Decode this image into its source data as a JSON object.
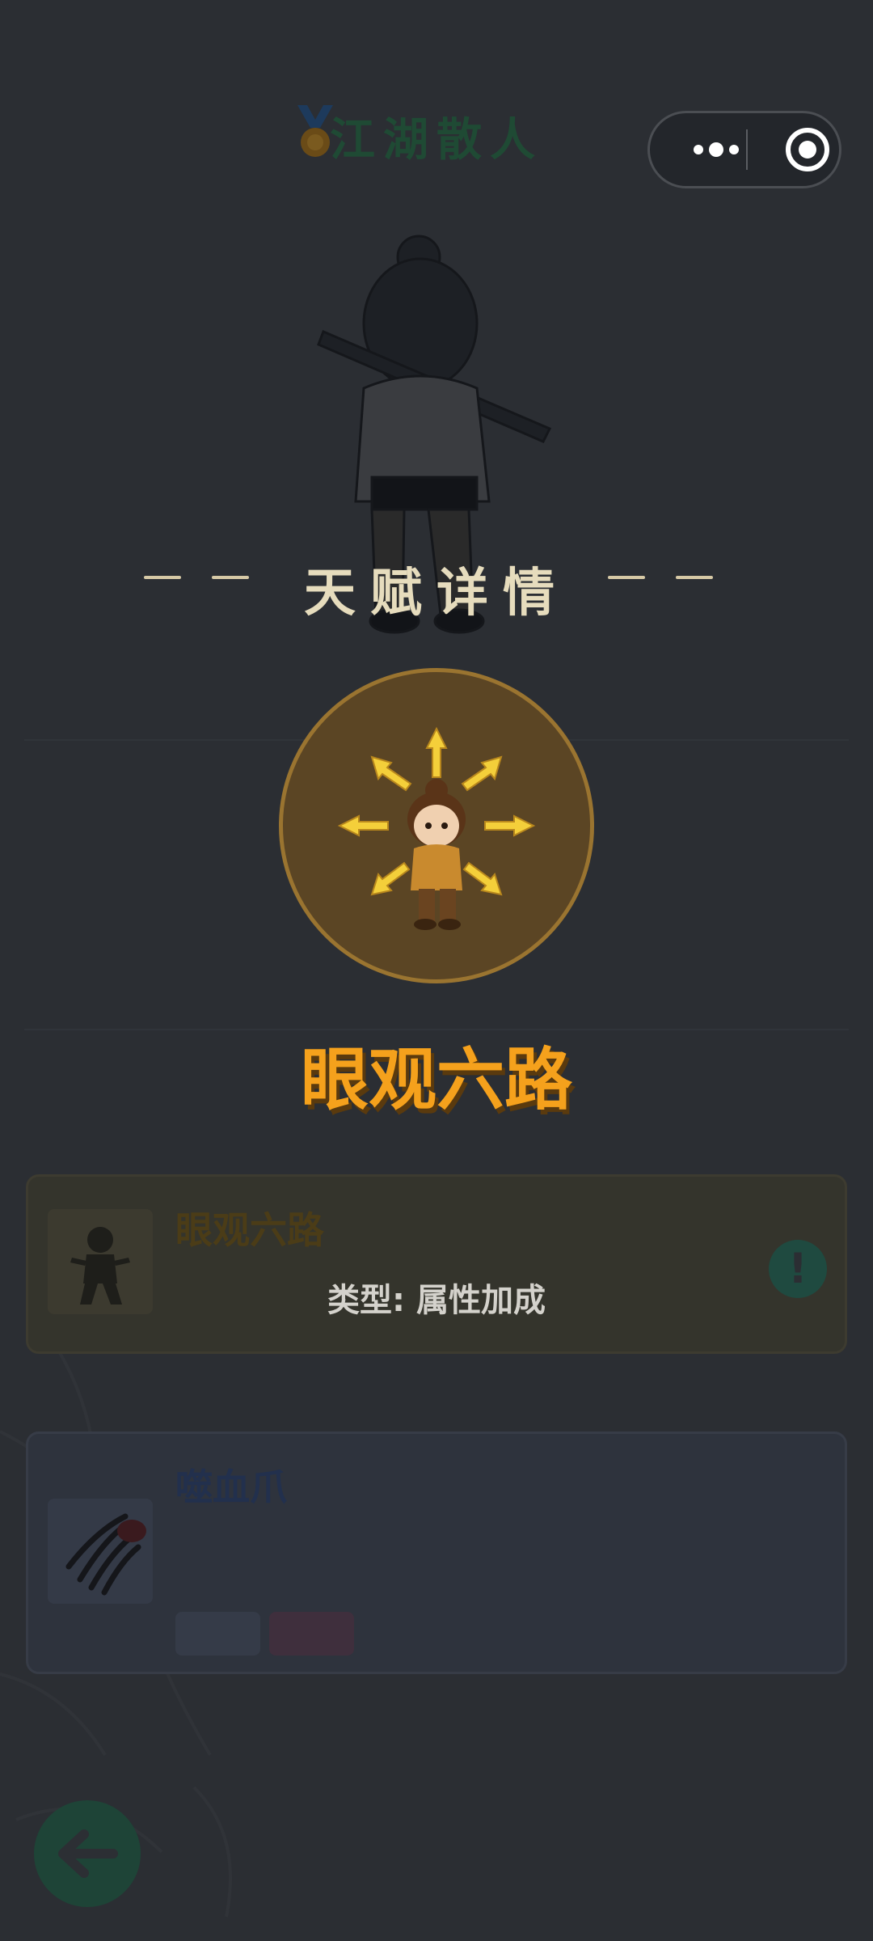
{
  "page": {
    "title": "江湖散人",
    "header_title": "天赋详情"
  },
  "capsule": {
    "more_icon": "more-dots-icon",
    "target_icon": "target-icon"
  },
  "talent": {
    "name": "眼观六路",
    "type_text": "类型: 属性加成",
    "accent_color": "#f5a11c",
    "circle_color": "#5b4524"
  },
  "cards": [
    {
      "name": "眼观六路",
      "icon": "fighter-thumbnail"
    },
    {
      "name": "噬血爪",
      "icon": "claw-thumbnail"
    }
  ],
  "back_icon": "arrow-left-icon"
}
